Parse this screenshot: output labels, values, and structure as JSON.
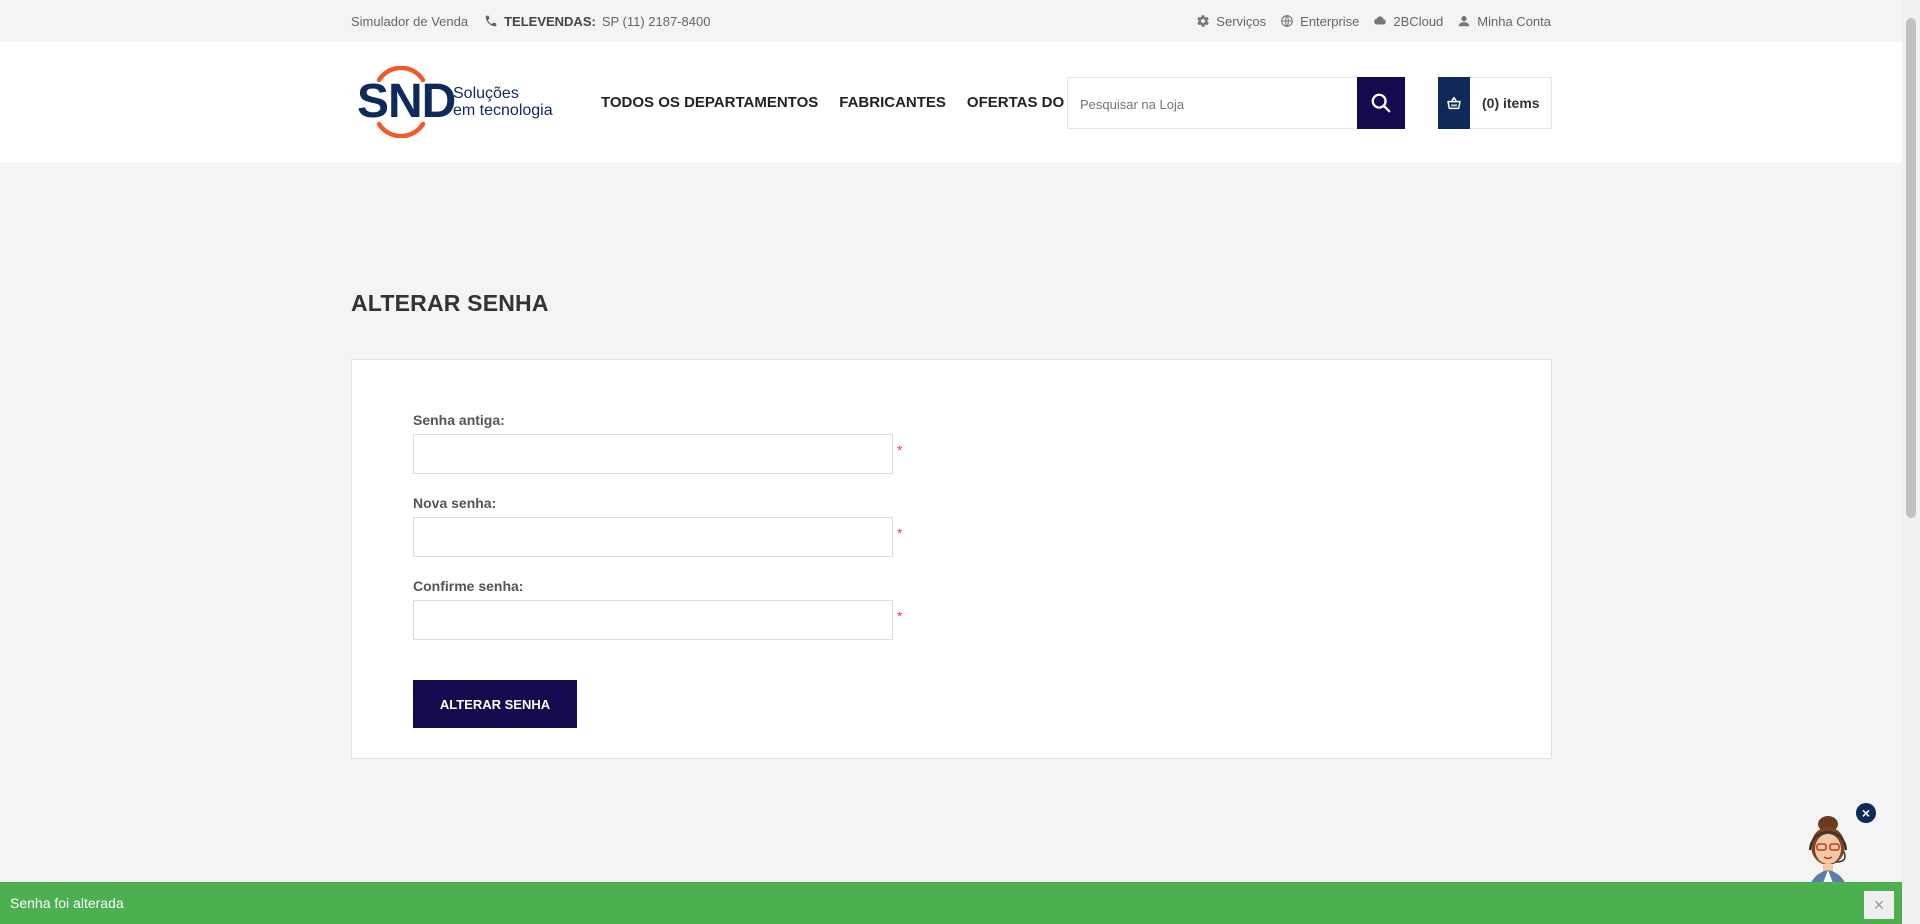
{
  "topbar": {
    "simulator": "Simulador de Venda",
    "televendas_label": "TELEVENDAS:",
    "televendas_phone": "SP (11)  2187-8400",
    "links": [
      "Serviços",
      "Enterprise",
      "2BCloud",
      "Minha Conta"
    ]
  },
  "header": {
    "logo_text": "SND",
    "logo_tag_line1": "Soluções",
    "logo_tag_line2": "em tecnologia",
    "nav": [
      "TODOS OS DEPARTAMENTOS",
      "FABRICANTES",
      "OFERTAS DO DIA"
    ],
    "search_placeholder": "Pesquisar na Loja",
    "cart_label": "(0) items"
  },
  "main": {
    "title": "ALTERAR SENHA",
    "fields": [
      {
        "label": "Senha antiga:",
        "required": "*"
      },
      {
        "label": "Nova senha:",
        "required": "*"
      },
      {
        "label": "Confirme senha:",
        "required": "*"
      }
    ],
    "submit_label": "ALTERAR SENHA"
  },
  "notification": {
    "message": "Senha foi alterada",
    "close": "×"
  },
  "chat": {
    "close": "×"
  },
  "colors": {
    "primary_dark": "#140a4d",
    "brand_blue": "#0e2a5b",
    "brand_orange": "#f05a28",
    "success_green": "#4caf50",
    "required_red": "#e4434b"
  }
}
